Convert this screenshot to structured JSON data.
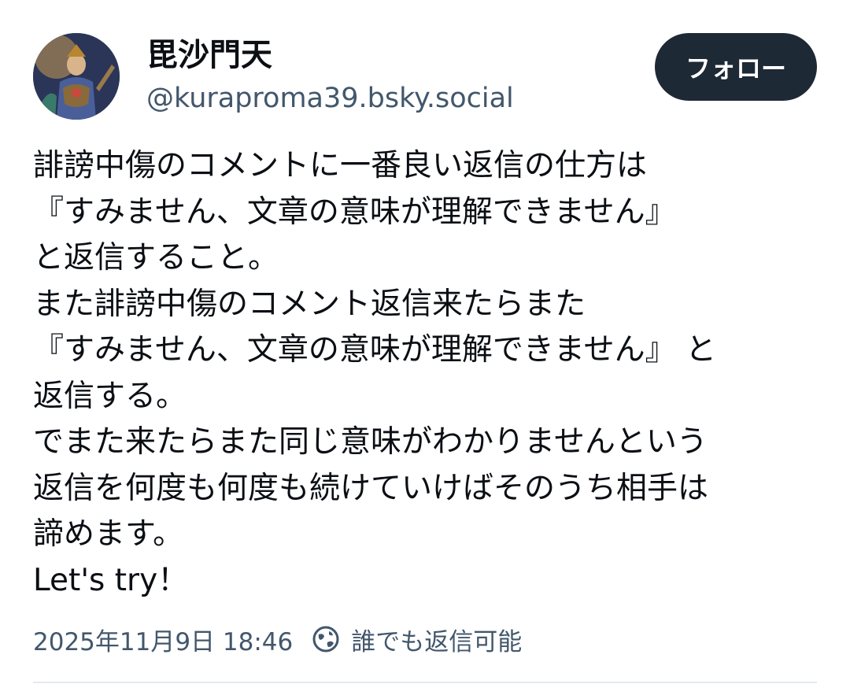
{
  "post": {
    "author": {
      "display_name": "毘沙門天",
      "handle": "@kuraproma39.bsky.social",
      "avatar_icon": "avatar-image"
    },
    "follow_label": "フォロー",
    "text_lines": [
      "誹謗中傷のコメントに一番良い返信の仕方は",
      "『すみません、文章の意味が理解できません』",
      "と返信すること。",
      "また誹謗中傷のコメント返信来たらまた",
      "『すみません、文章の意味が理解できません』 と",
      "返信する。",
      "でまた来たらまた同じ意味がわかりませんという",
      "返信を何度も何度も続けていけばそのうち相手は",
      "諦めます。",
      "Let's try！"
    ],
    "timestamp": "2025年11月9日 18:46",
    "reply_setting_icon": "globe-reply-icon",
    "reply_setting": "誰でも返信可能"
  },
  "colors": {
    "follow_button_bg": "#1e2936",
    "secondary_text": "#42576c",
    "primary_text": "#0b0f14",
    "divider": "#e4e9ee"
  }
}
